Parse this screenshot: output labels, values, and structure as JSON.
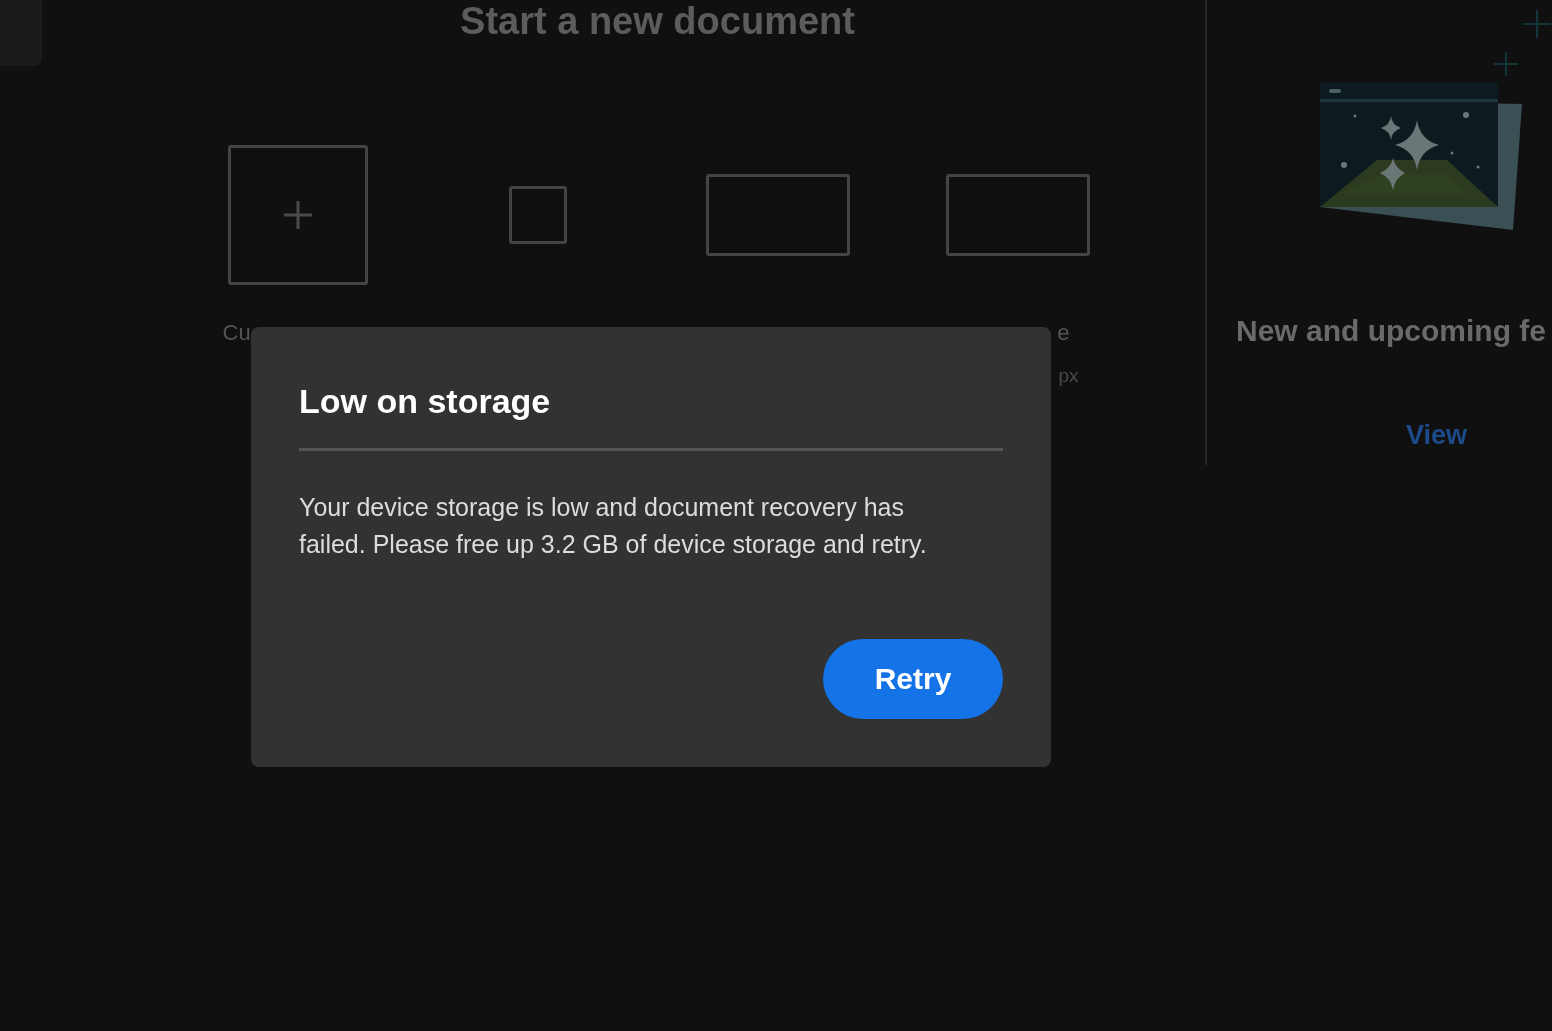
{
  "start_screen": {
    "heading": "Start a new document",
    "presets": [
      {
        "kind": "custom",
        "label": "Cu"
      },
      {
        "kind": "square"
      },
      {
        "kind": "wide"
      },
      {
        "kind": "wide",
        "label": "e",
        "size": "px"
      }
    ]
  },
  "whats_new": {
    "title": "New and upcoming fe",
    "link": "View"
  },
  "dialog": {
    "title": "Low on storage",
    "message": "Your device storage is low and document recovery has failed. Please free up 3.2 GB of device storage and retry.",
    "buttons": [
      {
        "label": "Retry",
        "kind": "primary"
      }
    ]
  }
}
